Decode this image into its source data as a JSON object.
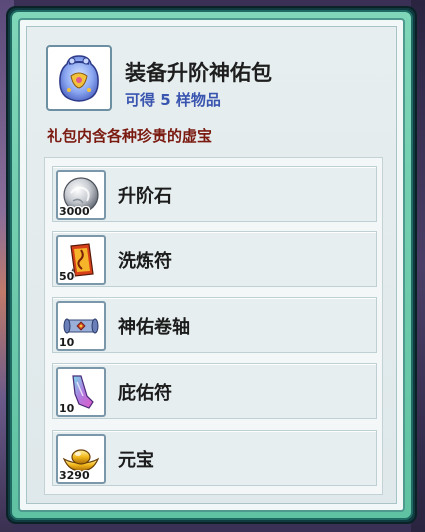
{
  "header": {
    "title": "装备升阶神佑包",
    "subtitle": "可得 5 样物品",
    "icon": "blessing-pack-icon"
  },
  "description": "礼包内含各种珍贵的虚宝",
  "items": [
    {
      "name": "升阶石",
      "quantity": "3000",
      "icon": "upgrade-stone-icon"
    },
    {
      "name": "洗炼符",
      "quantity": "50",
      "icon": "refine-talisman-icon"
    },
    {
      "name": "神佑卷轴",
      "quantity": "10",
      "icon": "blessing-scroll-icon"
    },
    {
      "name": "庇佑符",
      "quantity": "10",
      "icon": "protection-talisman-icon"
    },
    {
      "name": "元宝",
      "quantity": "3290",
      "icon": "gold-ingot-icon"
    }
  ],
  "colors": {
    "frame_green": "#5fc2a2",
    "subtitle_blue": "#3a55b0",
    "description_red": "#7a1a10"
  }
}
